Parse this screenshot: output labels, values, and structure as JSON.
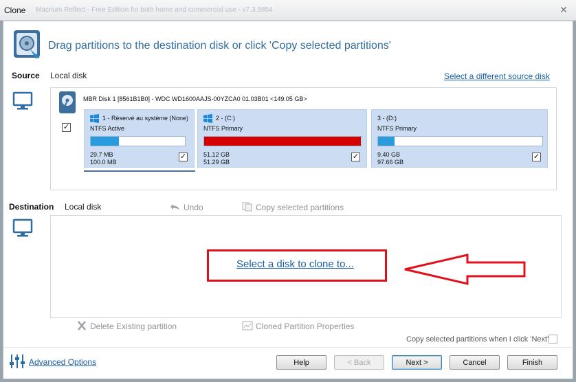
{
  "window": {
    "title": "Clone",
    "faded_title": "Macrium Reflect - Free Edition for both home and commercial use - v7.3.5854"
  },
  "header": {
    "instruction": "Drag partitions to the destination disk or click 'Copy selected partitions'"
  },
  "source": {
    "label": "Source",
    "disk_type": "Local disk",
    "select_link": "Select a different source disk",
    "disk_title": "MBR Disk 1 [8561B1B0] - WDC WD1600AAJS-00YZCA0 01.03B01  <149.05 GB>",
    "disk_checked": "✓",
    "partitions": [
      {
        "title": "1 - Réservé au système (None)",
        "type": "NTFS Active",
        "used": "29.7 MB",
        "total": "100.0 MB",
        "fill_fraction": 0.3,
        "fill_color": "#2a9bdc",
        "checked": "✓"
      },
      {
        "title": "2 -  (C:)",
        "type": "NTFS Primary",
        "used": "51.12 GB",
        "total": "51.29 GB",
        "fill_fraction": 0.997,
        "fill_color": "#d40000",
        "checked": "✓"
      },
      {
        "title": "3 -  (D:)",
        "type": "NTFS Primary",
        "used": "9.40 GB",
        "total": "97.66 GB",
        "fill_fraction": 0.1,
        "fill_color": "#2a9bdc",
        "checked": "✓"
      }
    ]
  },
  "destination": {
    "label": "Destination",
    "disk_type": "Local disk",
    "undo": "Undo",
    "copy_selected": "Copy selected partitions",
    "select_disk_link": "Select a disk to clone to...",
    "delete_partition": "Delete Existing partition",
    "cloned_props": "Cloned Partition Properties",
    "copy_on_next": "Copy selected partitions when I click 'Next'"
  },
  "footer": {
    "advanced_options": "Advanced Options",
    "help": "Help",
    "back": "< Back",
    "next": "Next >",
    "cancel": "Cancel",
    "finish": "Finish"
  },
  "colors": {
    "accent": "#2f6e9f",
    "link": "#1a5fa6",
    "highlight": "#e0101c",
    "partition_bg": "#ccddf3"
  },
  "icons": {
    "app": "clone-disk-icon",
    "source_computer": "monitor-icon",
    "dest_computer": "monitor-icon",
    "hdd": "hard-disk-icon",
    "windows": "windows-logo-icon",
    "undo": "undo-icon",
    "copy": "copy-icon",
    "delete": "x-icon",
    "properties": "properties-icon",
    "advanced": "sliders-icon"
  }
}
